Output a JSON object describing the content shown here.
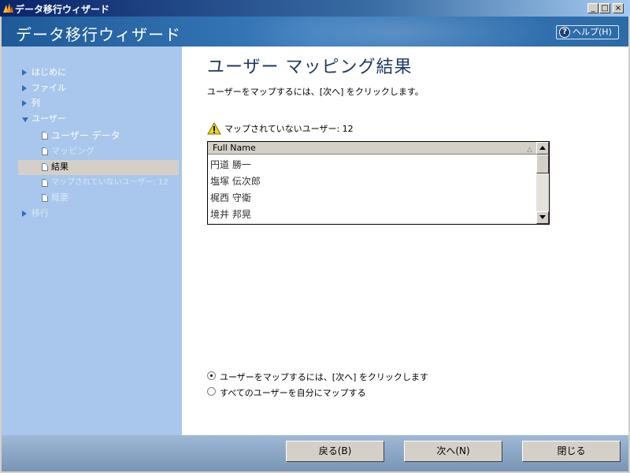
{
  "window": {
    "title": "データ移行ウィザード",
    "min_glyph": "_",
    "max_glyph": "□",
    "close_glyph": "×"
  },
  "header": {
    "title": "データ移行ウィザード",
    "help_label": "ヘルプ(H)",
    "help_glyph": "?"
  },
  "sidebar": {
    "items": [
      {
        "label": "はじめに"
      },
      {
        "label": "ファイル"
      },
      {
        "label": "列"
      },
      {
        "label": "ユーザー"
      },
      {
        "label": "移行"
      }
    ],
    "sub_items": [
      {
        "label": "ユーザー データ"
      },
      {
        "label": "マッピング"
      },
      {
        "label": "結果"
      },
      {
        "label": "マップされていないユーザー: 12"
      },
      {
        "label": "概要"
      }
    ]
  },
  "main": {
    "title": "ユーザー マッピング結果",
    "instruction": "ユーザーをマップするには、[次へ] をクリックします。",
    "warning": "マップされていないユーザー: 12",
    "list": {
      "header": "Full Name",
      "rows": [
        "円道 勝一",
        "塩塚 伝次郎",
        "梶西 守衛",
        "境井 邦晃"
      ]
    },
    "radios": [
      {
        "label": "ユーザーをマップするには、[次へ] をクリックします",
        "checked": true
      },
      {
        "label": "すべてのユーザーを自分にマップする",
        "checked": false
      }
    ]
  },
  "footer": {
    "back": "戻る(B)",
    "next": "次へ(N)",
    "close": "閉じる"
  },
  "colors": {
    "sidebar_bg": "#a9c7ec",
    "header_bg": "#2c6aa8",
    "title_color": "#1b3a66",
    "nav_triangle": "#2b6fc4",
    "footer_bg": "#8aa6c6"
  }
}
